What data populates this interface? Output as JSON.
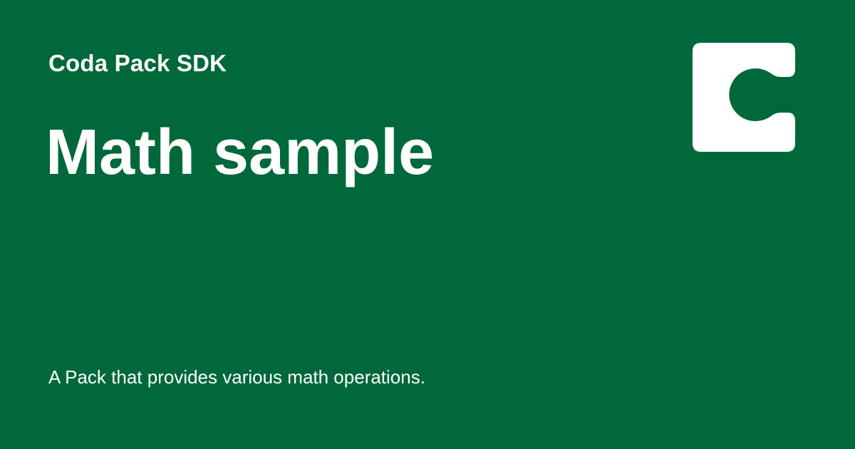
{
  "header": {
    "eyebrow": "Coda Pack SDK"
  },
  "main": {
    "title": "Math sample",
    "description": "A Pack that provides various math operations."
  },
  "logo": {
    "icon": "coda-logo-icon"
  },
  "colors": {
    "background": "#00683A",
    "text": "#FFFFFF",
    "logo": "#FFFFFF"
  }
}
